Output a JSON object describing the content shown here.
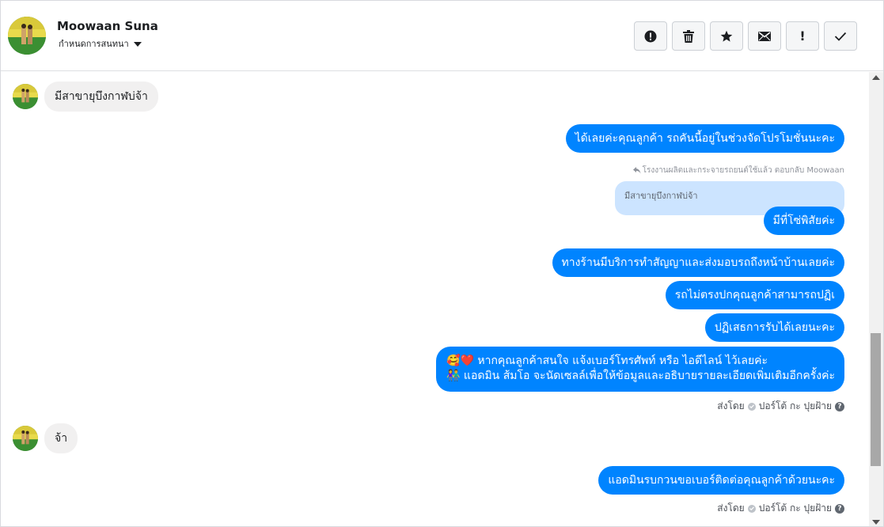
{
  "header": {
    "contact_name": "Moowaan Suna",
    "label_text": "กำหนดการสนทนา",
    "toolbar": [
      {
        "name": "report-button",
        "icon": "alert-circle-icon"
      },
      {
        "name": "delete-button",
        "icon": "trash-icon"
      },
      {
        "name": "star-button",
        "icon": "star-icon"
      },
      {
        "name": "mark-unread-button",
        "icon": "envelope-icon"
      },
      {
        "name": "important-button",
        "icon": "exclamation-icon",
        "glyph": "!"
      },
      {
        "name": "done-button",
        "icon": "check-icon"
      }
    ]
  },
  "messages": {
    "m1_in": "มีสาขายุบึงกาฬบ่จ้า",
    "m2_out": "ได้เลยค่ะคุณลูกค้า รถคันนี้อยู่ในช่วงจัดโปรโมชั่นนะคะ",
    "reply_note": "โรงงานผลิตและกระจายรถยนต์ใช้แล้ว ตอบกลับ Moowaan",
    "quoted_text": "มีสาขายุบึงกาฬบ่จ้า",
    "m3_out": "มีที่โซ่พิสัยค่ะ",
    "m4_out": "ทางร้านมีบริการทำสัญญาและส่งมอบรถถึงหน้าบ้านเลยค่ะ",
    "m5_out": "รถไม่ตรงปกคุณลูกค้าสามารถปฏิเ",
    "m6_out": "ปฏิเสธการรับได้เลยนะคะ",
    "m7_out_line1": "🥰❤️ หากคุณลูกค้าสนใจ แจ้งเบอร์โทรศัพท์ หรือ ไอดีไลน์  ไว้เลยค่ะ",
    "m7_out_line2": "👫 แอดมิน ส้มโอ จะนัดเซลล์เพื่อให้ข้อมูลและอธิบายรายละเอียดเพิ่มเติมอีกครั้งค่ะ",
    "sent_by_label": "ส่งโดย",
    "sent_by_name": "ปอร์โต้ กะ ปุยฝ้าย",
    "m8_in": "จ้า",
    "m9_out": "แอดมินรบกวนขอเบอร์ติดต่อคุณลูกค้าด้วยนะคะ",
    "sent_by_label_2": "ส่งโดย",
    "sent_by_name_2": "ปอร์โต้ กะ ปุยฝ้าย"
  },
  "colors": {
    "outgoing_bubble": "#0084ff",
    "incoming_bubble": "#f1f0f0",
    "quote_bubble": "#cce4ff"
  }
}
